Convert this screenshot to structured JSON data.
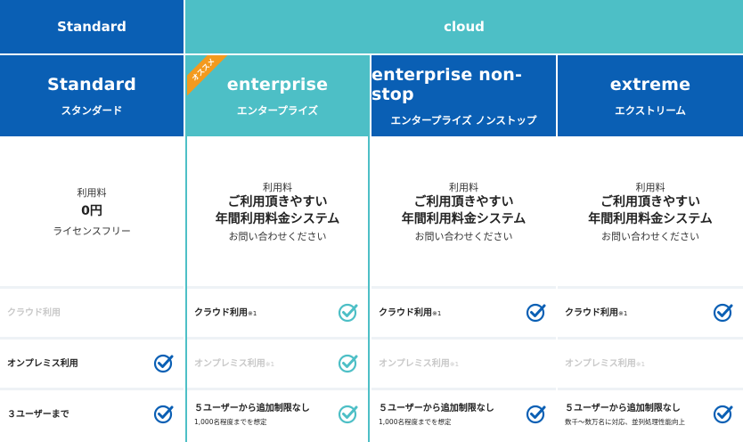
{
  "header": {
    "standard_label": "Standard",
    "cloud_label": "cloud"
  },
  "ribbon_label": "オススメ",
  "colors": {
    "blue": "#0a5fb4",
    "teal": "#4dbfc6",
    "ribbon": "#f39a1e"
  },
  "plans": [
    {
      "name": "Standard",
      "kana": "スタンダード",
      "price_label": "利用料",
      "price_main": "0円",
      "price_sub": "ライセンスフリー",
      "features": [
        {
          "text": "クラウド利用",
          "sup": "",
          "note": "",
          "enabled": false
        },
        {
          "text": "オンプレミス利用",
          "sup": "",
          "note": "",
          "enabled": true
        },
        {
          "text": "３ユーザーまで",
          "sup": "",
          "note": "",
          "enabled": true
        }
      ]
    },
    {
      "name": "enterprise",
      "kana": "エンタープライズ",
      "price_label": "利用料",
      "price_main_1": "ご利用頂きやすい",
      "price_main_2": "年間利用料金システム",
      "price_sub": "お問い合わせください",
      "features": [
        {
          "text": "クラウド利用",
          "sup": "※1",
          "note": "",
          "enabled": true
        },
        {
          "text": "オンプレミス利用",
          "sup": "※1",
          "note": "",
          "enabled": false
        },
        {
          "text": "５ユーザーから追加制限なし",
          "sup": "",
          "note": "1,000名程度までを想定",
          "enabled": true
        }
      ]
    },
    {
      "name": "enterprise non-stop",
      "kana": "エンタープライズ ノンストップ",
      "price_label": "利用料",
      "price_main_1": "ご利用頂きやすい",
      "price_main_2": "年間利用料金システム",
      "price_sub": "お問い合わせください",
      "features": [
        {
          "text": "クラウド利用",
          "sup": "※1",
          "note": "",
          "enabled": true
        },
        {
          "text": "オンプレミス利用",
          "sup": "※1",
          "note": "",
          "enabled": false
        },
        {
          "text": "５ユーザーから追加制限なし",
          "sup": "",
          "note": "1,000名程度までを想定",
          "enabled": true
        }
      ]
    },
    {
      "name": "extreme",
      "kana": "エクストリーム",
      "price_label": "利用料",
      "price_main_1": "ご利用頂きやすい",
      "price_main_2": "年間利用料金システム",
      "price_sub": "お問い合わせください",
      "features": [
        {
          "text": "クラウド利用",
          "sup": "※1",
          "note": "",
          "enabled": true
        },
        {
          "text": "オンプレミス利用",
          "sup": "※1",
          "note": "",
          "enabled": false
        },
        {
          "text": "５ユーザーから追加制限なし",
          "sup": "",
          "note": "数千～数万名に対応、並列処理性能向上",
          "enabled": true
        }
      ]
    }
  ]
}
